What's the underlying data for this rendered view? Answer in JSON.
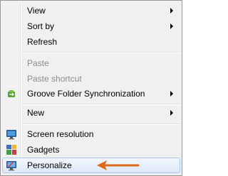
{
  "menu": {
    "items": [
      {
        "label": "View",
        "submenu": true
      },
      {
        "label": "Sort by",
        "submenu": true
      },
      {
        "label": "Refresh",
        "submenu": false
      },
      {
        "label": "Paste",
        "disabled": true
      },
      {
        "label": "Paste shortcut",
        "disabled": true
      },
      {
        "label": "Groove Folder Synchronization",
        "submenu": true,
        "icon": "groove-sync-icon"
      },
      {
        "label": "New",
        "submenu": true
      },
      {
        "label": "Screen resolution",
        "icon": "monitor-icon"
      },
      {
        "label": "Gadgets",
        "icon": "gadgets-icon"
      },
      {
        "label": "Personalize",
        "icon": "personalize-icon",
        "highlighted": true
      }
    ]
  },
  "annotation": {
    "arrow_color": "#e06a1a",
    "points_to": "Personalize"
  },
  "colors": {
    "menu_bg": "#f0f0f0",
    "border": "#979797",
    "highlight_border": "#aac8ee",
    "disabled_text": "#8d8d8d"
  }
}
